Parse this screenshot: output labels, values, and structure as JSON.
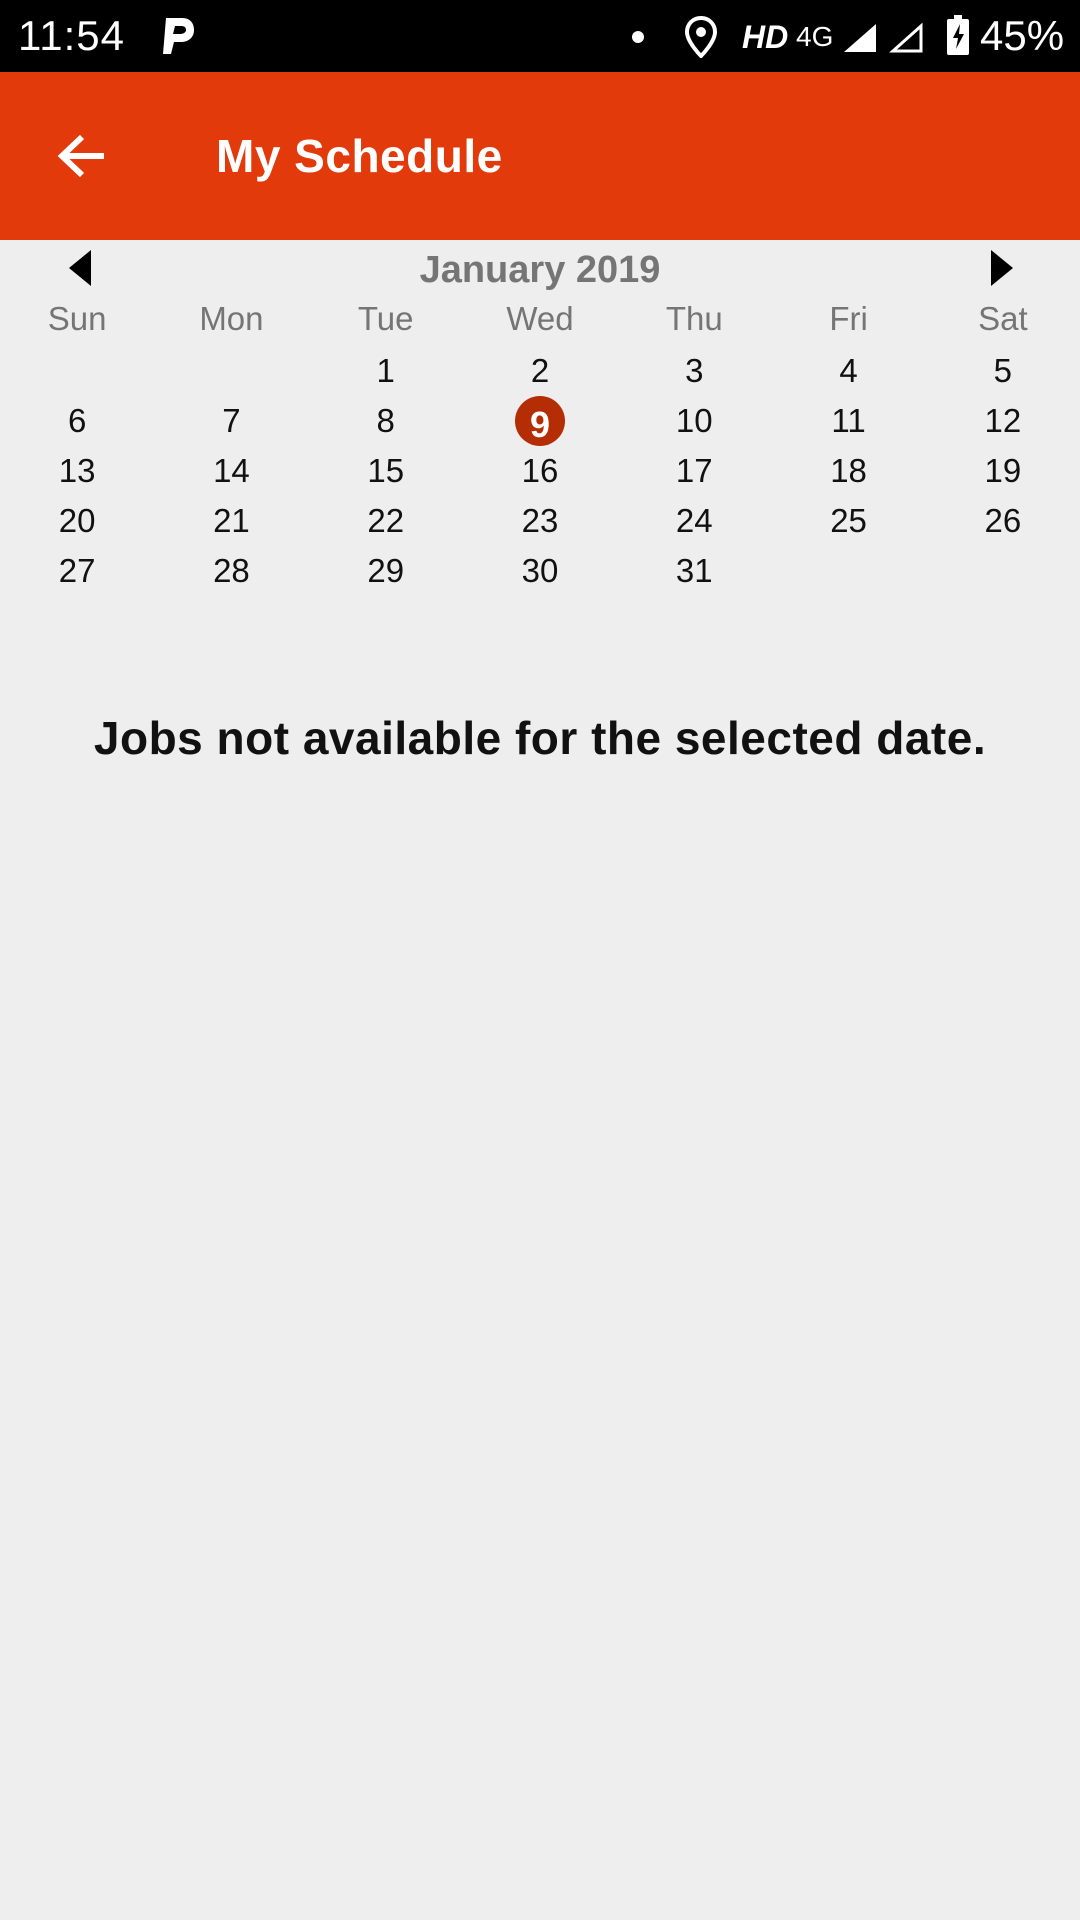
{
  "status_bar": {
    "time": "11:54",
    "hd": "HD",
    "network": "4G",
    "battery_percent": "45%",
    "icons": [
      "parking-p-icon",
      "notification-dot-icon",
      "location-icon",
      "signal-icon",
      "signal-empty-icon",
      "battery-charging-icon"
    ]
  },
  "app_bar": {
    "title": "My Schedule",
    "back_icon": "arrow-left-icon",
    "color": "#e23a0a"
  },
  "calendar": {
    "month_title": "January 2019",
    "prev_icon": "triangle-left-icon",
    "next_icon": "triangle-right-icon",
    "weekdays": [
      "Sun",
      "Mon",
      "Tue",
      "Wed",
      "Thu",
      "Fri",
      "Sat"
    ],
    "days": [
      "",
      "",
      "1",
      "2",
      "3",
      "4",
      "5",
      "6",
      "7",
      "8",
      "9",
      "10",
      "11",
      "12",
      "13",
      "14",
      "15",
      "16",
      "17",
      "18",
      "19",
      "20",
      "21",
      "22",
      "23",
      "24",
      "25",
      "26",
      "27",
      "28",
      "29",
      "30",
      "31",
      "",
      ""
    ],
    "selected_day": "9",
    "selected_color": "#b52d05"
  },
  "message": "Jobs not available for the selected date."
}
